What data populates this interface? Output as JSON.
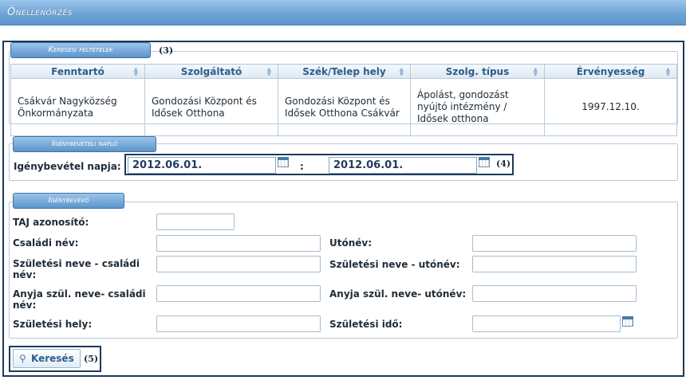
{
  "title": "Önellenőrzés",
  "search_criteria": {
    "legend": "Keresési feltételek",
    "marker": "(3)",
    "columns": [
      "Fenntartó",
      "Szolgáltató",
      "Szék/Telep hely",
      "Szolg. típus",
      "Érvényesség"
    ],
    "row": [
      "Csákvár Nagyközség Önkormányzata",
      "Gondozási Központ és Idősek Otthona",
      "Gondozási Központ és Idősek Otthona Csákvár",
      "Ápolást, gondozást nyújtó intézmény / Idősek otthona",
      "1997.12.10."
    ]
  },
  "claim_log": {
    "legend": "Igénybevételi napló",
    "date_label": "Igénybevétel napja:",
    "date_from": "2012.06.01.",
    "separator": ":",
    "date_to": "2012.06.01.",
    "marker": "(4)"
  },
  "claimant": {
    "legend": "Igénybevevő",
    "taj_label": "TAJ azonosító:",
    "family_name_label": "Családi név:",
    "given_name_label": "Utónév:",
    "birth_family_label": "Születési neve - családi név:",
    "birth_given_label": "Születési neve - utónév:",
    "mother_family_label": "Anyja szül. neve- családi név:",
    "mother_given_label": "Anyja szül. neve- utónév:",
    "birth_place_label": "Születési hely:",
    "birth_date_label": "Születési idő:"
  },
  "search_button": {
    "label": "Keresés",
    "marker": "(5)"
  },
  "icons": {
    "calendar": "calendar-icon",
    "search": "magnifier-icon"
  },
  "colors": {
    "accent": "#5f97cc",
    "frame": "#1c3a5c",
    "header_text": "#2d5d8a"
  }
}
